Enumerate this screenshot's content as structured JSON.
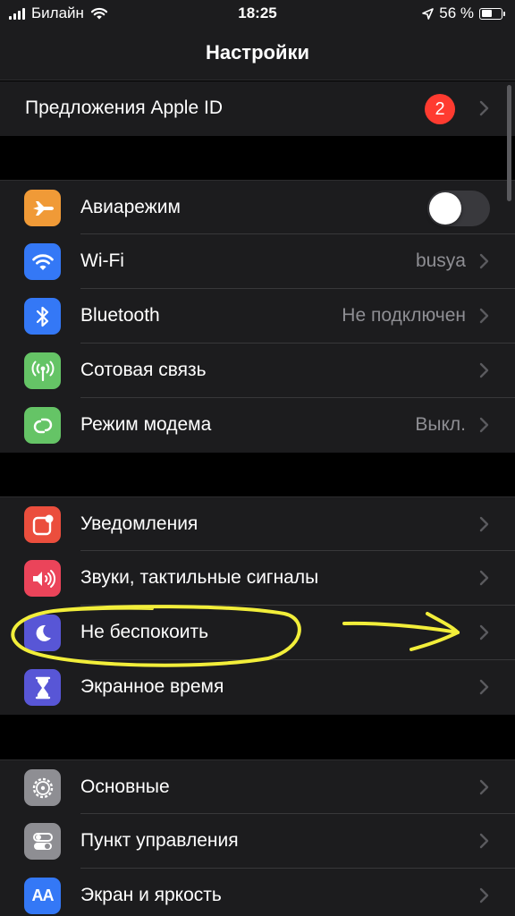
{
  "status_bar": {
    "carrier": "Билайн",
    "time": "18:25",
    "battery_percent": "56 %",
    "battery_level": 0.56
  },
  "nav": {
    "title": "Настройки"
  },
  "apple_id": {
    "label": "Предложения Apple ID",
    "badge": "2"
  },
  "groups": {
    "connectivity": [
      {
        "label": "Авиарежим",
        "icon": "airplane-icon",
        "color": "#f09a37",
        "value": "",
        "toggle": false
      },
      {
        "label": "Wi-Fi",
        "icon": "wifi-icon",
        "color": "#3478f6",
        "value": "busya"
      },
      {
        "label": "Bluetooth",
        "icon": "bluetooth-icon",
        "color": "#3478f6",
        "value": "Не подключен"
      },
      {
        "label": "Сотовая связь",
        "icon": "cellular-icon",
        "color": "#65c466",
        "value": ""
      },
      {
        "label": "Режим модема",
        "icon": "hotspot-icon",
        "color": "#65c466",
        "value": "Выкл."
      }
    ],
    "notifications": [
      {
        "label": "Уведомления",
        "icon": "notifications-icon",
        "color": "#eb4e3d"
      },
      {
        "label": "Звуки, тактильные сигналы",
        "icon": "sounds-icon",
        "color": "#eb445a"
      },
      {
        "label": "Не беспокоить",
        "icon": "moon-icon",
        "color": "#5856d6"
      },
      {
        "label": "Экранное время",
        "icon": "hourglass-icon",
        "color": "#5856d6"
      }
    ],
    "general": [
      {
        "label": "Основные",
        "icon": "gear-icon",
        "color": "#8e8e93"
      },
      {
        "label": "Пункт управления",
        "icon": "control-center-icon",
        "color": "#8e8e93"
      },
      {
        "label": "Экран и яркость",
        "icon": "display-icon",
        "color": "#3478f6",
        "icon_text": "AA"
      }
    ]
  },
  "colors": {
    "row_background": "#1c1c1e",
    "secondary_text": "#8e8e93",
    "annotation": "#f2ee3a"
  }
}
